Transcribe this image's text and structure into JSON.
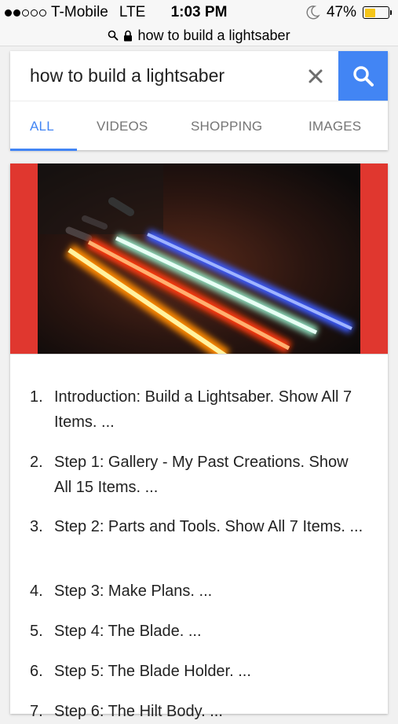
{
  "status_bar": {
    "carrier": "T-Mobile",
    "network": "LTE",
    "time": "1:03 PM",
    "battery": "47%",
    "battery_level": 0.47,
    "battery_color": "#f5c518"
  },
  "url_bar": {
    "url": "how to build a lightsaber",
    "icons": [
      "search-icon",
      "lock-icon"
    ]
  },
  "search": {
    "query": "how to build a lightsaber",
    "clear_icon": "close-icon",
    "search_icon": "search-icon",
    "accent_color": "#4285f4"
  },
  "tabs": [
    {
      "label": "ALL",
      "active": true
    },
    {
      "label": "VIDEOS",
      "active": false
    },
    {
      "label": "SHOPPING",
      "active": false
    },
    {
      "label": "IMAGES",
      "active": false
    }
  ],
  "result": {
    "image": "lightsabers-photo",
    "steps": [
      {
        "num": "1.",
        "text": "Introduction: Build a Lightsaber. Show All 7 Items. ..."
      },
      {
        "num": "2.",
        "text": "Step 1: Gallery - My Past Creations. Show All 15 Items. ..."
      },
      {
        "num": "3.",
        "text": "Step 2: Parts and Tools. Show All 7 Items. ..."
      },
      {
        "num": "4.",
        "text": "Step 3: Make Plans. ..."
      },
      {
        "num": "5.",
        "text": "Step 4: The Blade. ..."
      },
      {
        "num": "6.",
        "text": "Step 5: The Blade Holder. ..."
      },
      {
        "num": "7.",
        "text": "Step 6: The Hilt Body. ..."
      }
    ]
  }
}
